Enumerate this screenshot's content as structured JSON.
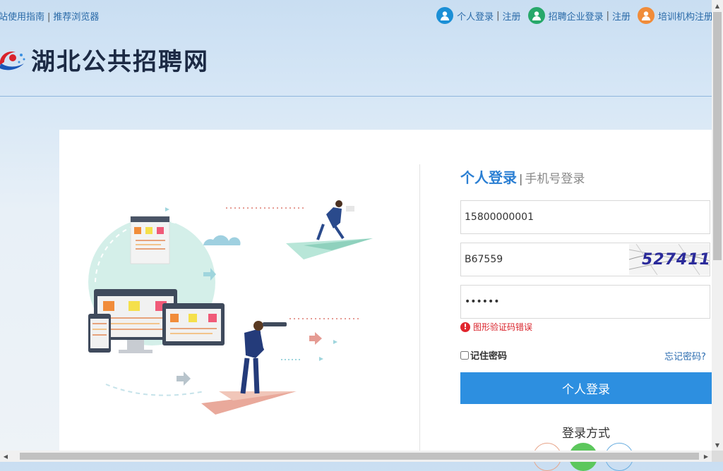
{
  "topbar": {
    "left_links": [
      "站使用指南",
      "推荐浏览器"
    ],
    "separator": "|",
    "personal": {
      "login": "个人登录",
      "register": "注册",
      "icon": "user-icon",
      "color": "#1b8fd6"
    },
    "company": {
      "login": "招聘企业登录",
      "register": "注册",
      "icon": "company-user-icon",
      "color": "#27a86a"
    },
    "training": {
      "register": "培训机构注册",
      "icon": "training-user-icon",
      "color": "#f08c3a"
    }
  },
  "brand": {
    "title": "湖北公共招聘网"
  },
  "login": {
    "tab_active": "个人登录",
    "tab_sep": "|",
    "tab_other": "手机号登录",
    "phone_value": "15800000001",
    "captcha_value": "B67559",
    "captcha_image_text": "527411",
    "password_value": "••••••",
    "error_text": "图形验证码错误",
    "error_icon": "!",
    "remember_label": "记住密码",
    "forgot_label": "忘记密码?",
    "submit_label": "个人登录",
    "ways_title": "登录方式",
    "accent": "#2d8fe0",
    "error_color": "#d9232b"
  },
  "scrollbars": {
    "up": "▲",
    "down": "▼",
    "left": "◀",
    "right": "▶"
  }
}
